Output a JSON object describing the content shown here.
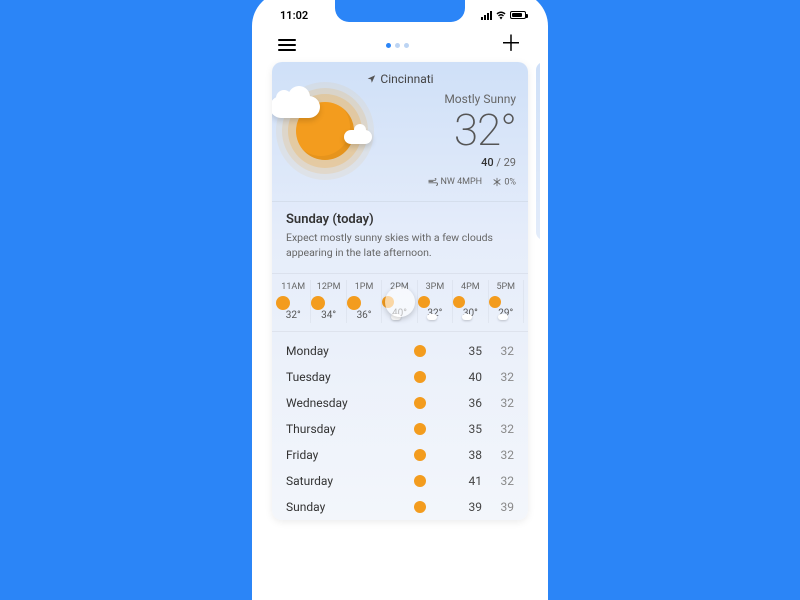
{
  "status": {
    "time": "11:02"
  },
  "location": {
    "name": "Cincinnati"
  },
  "current": {
    "condition": "Mostly Sunny",
    "temp": "32°",
    "high": "40",
    "low": "29",
    "wind": "NW 4MPH",
    "precip": "0%"
  },
  "today": {
    "title": "Sunday (today)",
    "desc": "Expect mostly sunny skies with a few clouds appearing in the late afternoon."
  },
  "hourly": [
    {
      "time": "11AM",
      "icon": "sun",
      "temp": "32°"
    },
    {
      "time": "12PM",
      "icon": "sun",
      "temp": "34°"
    },
    {
      "time": "1PM",
      "icon": "sun",
      "temp": "36°"
    },
    {
      "time": "2PM",
      "icon": "partly",
      "temp": "40°"
    },
    {
      "time": "3PM",
      "icon": "partly",
      "temp": "32°"
    },
    {
      "time": "4PM",
      "icon": "partly",
      "temp": "30°"
    },
    {
      "time": "5PM",
      "icon": "partly",
      "temp": "29°"
    }
  ],
  "daily": [
    {
      "day": "Monday",
      "hi": "35",
      "lo": "32"
    },
    {
      "day": "Tuesday",
      "hi": "40",
      "lo": "32"
    },
    {
      "day": "Wednesday",
      "hi": "36",
      "lo": "32"
    },
    {
      "day": "Thursday",
      "hi": "35",
      "lo": "32"
    },
    {
      "day": "Friday",
      "hi": "38",
      "lo": "32"
    },
    {
      "day": "Saturday",
      "hi": "41",
      "lo": "32"
    },
    {
      "day": "Sunday",
      "hi": "39",
      "lo": "39"
    }
  ]
}
